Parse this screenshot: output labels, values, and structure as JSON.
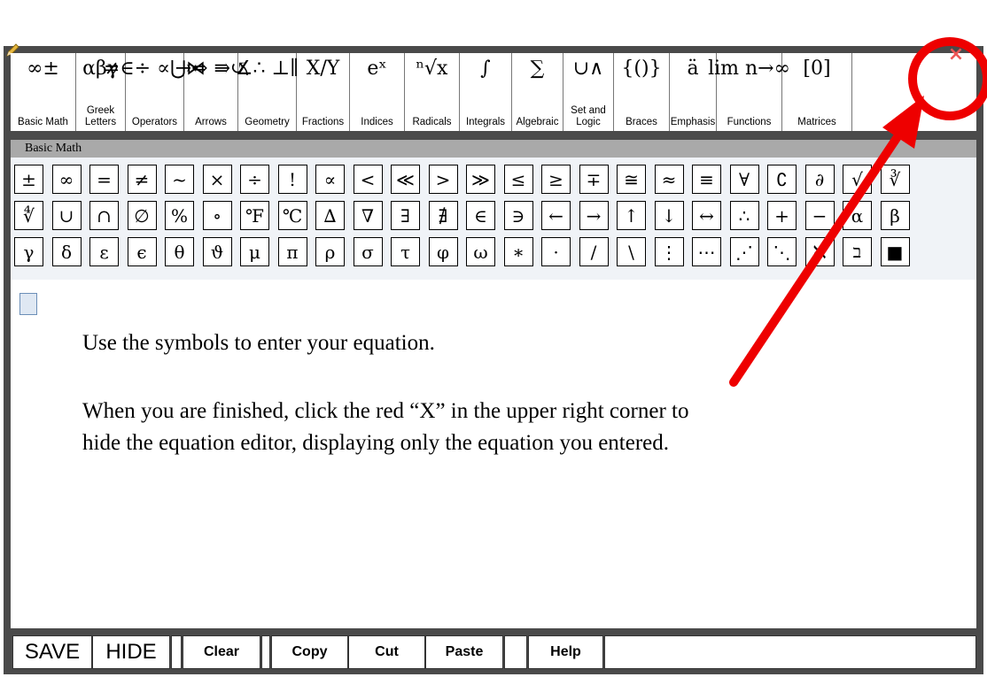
{
  "toolbar": {
    "buttons": [
      {
        "symbol": "∞±",
        "label": "Basic Math",
        "icon": "basic-math-icon"
      },
      {
        "symbol": "αβγ",
        "label": "Greek Letters",
        "icon": "greek-letters-icon"
      },
      {
        "symbol": "≠∈÷ ∝⋃⋈",
        "label": "Operators",
        "icon": "operators-icon"
      },
      {
        "symbol": "→⇔ ⇛↺",
        "label": "Arrows",
        "icon": "arrows-icon"
      },
      {
        "symbol": "∡∴ ⊥∥",
        "label": "Geometry",
        "icon": "geometry-icon"
      },
      {
        "symbol": "X/Y",
        "label": "Fractions",
        "icon": "fractions-icon"
      },
      {
        "symbol": "eˣ",
        "label": "Indices",
        "icon": "indices-icon"
      },
      {
        "symbol": "ⁿ√x",
        "label": "Radicals",
        "icon": "radicals-icon"
      },
      {
        "symbol": "∫",
        "label": "Integrals",
        "icon": "integrals-icon"
      },
      {
        "symbol": "∑",
        "label": "Algebraic",
        "icon": "algebraic-icon"
      },
      {
        "symbol": "∪∧",
        "label": "Set and Logic",
        "icon": "set-logic-icon"
      },
      {
        "symbol": "{()}",
        "label": "Braces",
        "icon": "braces-icon"
      },
      {
        "symbol": "ä",
        "label": "Emphasis",
        "icon": "emphasis-icon"
      },
      {
        "symbol": "lim n→∞",
        "label": "Functions",
        "icon": "functions-icon"
      },
      {
        "symbol": "[0]",
        "label": "Matrices",
        "icon": "matrices-icon"
      }
    ]
  },
  "palette": {
    "title": "Basic Math",
    "symbols": [
      "±",
      "∞",
      "=",
      "≠",
      "~",
      "×",
      "÷",
      "!",
      "∝",
      "<",
      "≪",
      ">",
      "≫",
      "≤",
      "≥",
      "∓",
      "≅",
      "≈",
      "≡",
      "∀",
      "∁",
      "∂",
      "√",
      "∛",
      "∜",
      "∪",
      "∩",
      "∅",
      "%",
      "∘",
      "℉",
      "℃",
      "∆",
      "∇",
      "∃",
      "∄",
      "∈",
      "∋",
      "←",
      "→",
      "↑",
      "↓",
      "↔",
      "∴",
      "+",
      "−",
      "α",
      "β",
      "γ",
      "δ",
      "ε",
      "ϵ",
      "θ",
      "ϑ",
      "μ",
      "π",
      "ρ",
      "σ",
      "τ",
      "φ",
      "ω",
      "∗",
      "·",
      "/",
      "\\",
      "⋮",
      "⋯",
      "⋰",
      "⋱",
      "ℵ",
      "ב",
      "■"
    ]
  },
  "instructions": {
    "line1": "Use the symbols to enter your equation.",
    "line2": "When you are finished, click the red “X” in the upper right corner to hide the equation editor, displaying only the equation you entered."
  },
  "bottom_bar": {
    "save": "SAVE",
    "hide": "HIDE",
    "clear": "Clear",
    "copy": "Copy",
    "cut": "Cut",
    "paste": "Paste",
    "help": "Help"
  },
  "close_button": {
    "label": "×",
    "color": "#ee5555"
  },
  "annotation": {
    "color": "#ee0000"
  }
}
